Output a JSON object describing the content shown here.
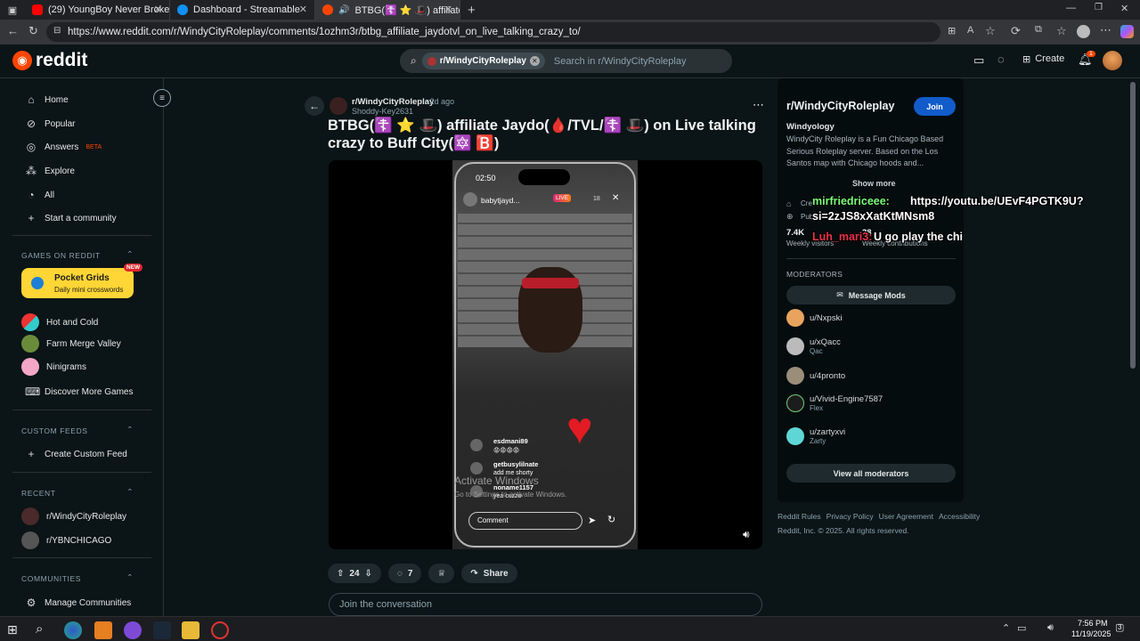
{
  "browser": {
    "tabs": [
      {
        "title": "(29) YoungBoy Never Broke Again",
        "active": false
      },
      {
        "title": "Dashboard - Streamable",
        "active": false
      },
      {
        "title": "BTBG(☦️ ⭐ 🎩) affiliate Jaydo",
        "active": true
      }
    ],
    "url": "https://www.reddit.com/r/WindyCityRoleplay/comments/1ozhm3r/btbg_affiliate_jaydotvl_on_live_talking_crazy_to/"
  },
  "header": {
    "logo_text": "reddit",
    "search_chip": "r/WindyCityRoleplay",
    "search_placeholder": "Search in r/WindyCityRoleplay",
    "create_label": "Create",
    "notif_count": "1"
  },
  "sidebar": {
    "nav": [
      "Home",
      "Popular",
      "Answers",
      "Explore",
      "All",
      "Start a community"
    ],
    "answers_badge": "BETA",
    "games_header": "GAMES ON REDDIT",
    "pocket_title": "Pocket Grids",
    "pocket_sub": "Daily mini crosswords",
    "pocket_badge": "NEW",
    "games": [
      "Hot and Cold",
      "Farm Merge Valley",
      "Ninigrams",
      "Discover More Games"
    ],
    "custom_header": "CUSTOM FEEDS",
    "create_feed": "Create Custom Feed",
    "recent_header": "RECENT",
    "recent": [
      "r/WindyCityRoleplay",
      "r/YBNCHICAGO"
    ],
    "communities_header": "COMMUNITIES",
    "manage": "Manage Communities"
  },
  "post": {
    "subreddit": "r/WindyCityRoleplay",
    "age": "• 2d ago",
    "author": "Shoddy-Key2631",
    "title": "BTBG(☦️ ⭐ 🎩) affiliate Jaydo(🩸/TVL/☦️ 🎩) on Live talking crazy to Buff City(🔯 🅱️)",
    "upvotes": "24",
    "comments": "7",
    "share": "Share",
    "join_placeholder": "Join the conversation"
  },
  "video": {
    "time": "02:50",
    "live_user": "babytjayd...",
    "live_badge": "LIVE",
    "viewers": "18",
    "comments": [
      {
        "user": "esdmani89",
        "text": "😡😡😡😡"
      },
      {
        "user": "getbusylilnate",
        "text": "add me shorty"
      },
      {
        "user": "noname1157",
        "text": "yea cuzzo"
      }
    ],
    "comment_placeholder": "Comment",
    "watermark1": "Activate Windows",
    "watermark2": "Go to Settings to activate Windows."
  },
  "community": {
    "name": "r/WindyCityRoleplay",
    "join": "Join",
    "subtitle": "Windyology",
    "desc": "WindyCity Roleplay is a Fun Chicago Based Serious Roleplay server. Based on the Los Santos map with Chicago hoods and...",
    "show_more": "Show more",
    "created_partial": "Cre",
    "public_partial": "Pub",
    "members": "7.4K",
    "members_label": "Weekly visitors",
    "contrib": "38",
    "contrib_label": "Weekly contributions",
    "mods_header": "MODERATORS",
    "message_mods": "Message Mods",
    "mods": [
      {
        "name": "u/Nxpski",
        "flair": ""
      },
      {
        "name": "u/xQacc",
        "flair": "Qac"
      },
      {
        "name": "u/4pronto",
        "flair": ""
      },
      {
        "name": "u/Vivid-Engine7587",
        "flair": "Flex"
      },
      {
        "name": "u/zartyxvi",
        "flair": "Zarty"
      }
    ],
    "view_all": "View all moderators"
  },
  "footer_links": [
    "Reddit Rules",
    "Privacy Policy",
    "User Agreement",
    "Accessibility"
  ],
  "copyright": "Reddit, Inc. © 2025. All rights reserved.",
  "overlay": {
    "user1": "mirfriedriceee:",
    "msg1a": "https://youtu.be/UEvF4PGTK9U?",
    "msg1b": "si=2zJS8xXatKtMNsm8",
    "user2": "Luh_mari3:",
    "msg2": "U go play the chi"
  },
  "taskbar": {
    "time": "7:56 PM",
    "date": "11/19/2025",
    "notif": "3"
  }
}
